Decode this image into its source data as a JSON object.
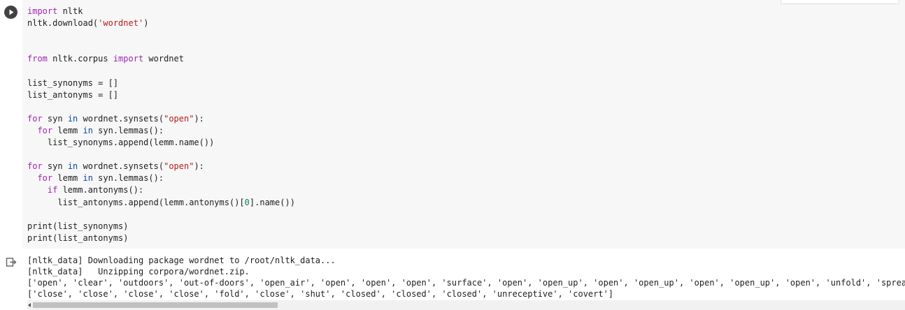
{
  "cell": {
    "run_icon": "play-circle-icon",
    "output_icon": "output-arrow-icon",
    "code_lines": [
      [
        {
          "t": "import",
          "c": "kw"
        },
        {
          "t": " nltk",
          "c": ""
        }
      ],
      [
        {
          "t": "nltk.download(",
          "c": ""
        },
        {
          "t": "'wordnet'",
          "c": "str"
        },
        {
          "t": ")",
          "c": ""
        }
      ],
      [],
      [],
      [
        {
          "t": "from",
          "c": "kw"
        },
        {
          "t": " nltk.corpus ",
          "c": ""
        },
        {
          "t": "import",
          "c": "kw"
        },
        {
          "t": " wordnet",
          "c": ""
        }
      ],
      [],
      [
        {
          "t": "list_synonyms = []",
          "c": ""
        }
      ],
      [
        {
          "t": "list_antonyms = []",
          "c": ""
        }
      ],
      [],
      [
        {
          "t": "for",
          "c": "kw"
        },
        {
          "t": " syn ",
          "c": ""
        },
        {
          "t": "in",
          "c": "kw2"
        },
        {
          "t": " wordnet.synsets(",
          "c": ""
        },
        {
          "t": "\"open\"",
          "c": "str"
        },
        {
          "t": "):",
          "c": ""
        }
      ],
      [
        {
          "t": "  ",
          "c": ""
        },
        {
          "t": "for",
          "c": "kw"
        },
        {
          "t": " lemm ",
          "c": ""
        },
        {
          "t": "in",
          "c": "kw2"
        },
        {
          "t": " syn.lemmas():",
          "c": ""
        }
      ],
      [
        {
          "t": "    list_synonyms.append(lemm.name())",
          "c": ""
        }
      ],
      [],
      [
        {
          "t": "for",
          "c": "kw"
        },
        {
          "t": " syn ",
          "c": ""
        },
        {
          "t": "in",
          "c": "kw2"
        },
        {
          "t": " wordnet.synsets(",
          "c": ""
        },
        {
          "t": "\"open\"",
          "c": "str"
        },
        {
          "t": "):",
          "c": ""
        }
      ],
      [
        {
          "t": "  ",
          "c": ""
        },
        {
          "t": "for",
          "c": "kw"
        },
        {
          "t": " lemm ",
          "c": ""
        },
        {
          "t": "in",
          "c": "kw2"
        },
        {
          "t": " syn.lemmas():",
          "c": ""
        }
      ],
      [
        {
          "t": "    ",
          "c": ""
        },
        {
          "t": "if",
          "c": "kw"
        },
        {
          "t": " lemm.antonyms():",
          "c": ""
        }
      ],
      [
        {
          "t": "      list_antonyms.append(lemm.antonyms()[",
          "c": ""
        },
        {
          "t": "0",
          "c": "num"
        },
        {
          "t": "].name())",
          "c": ""
        }
      ],
      [],
      [
        {
          "t": "print(list_synonyms)",
          "c": ""
        }
      ],
      [
        {
          "t": "print(list_antonyms)",
          "c": ""
        }
      ]
    ],
    "output_lines": [
      "[nltk_data] Downloading package wordnet to /root/nltk_data...",
      "[nltk_data]   Unzipping corpora/wordnet.zip.",
      "['open', 'clear', 'outdoors', 'out-of-doors', 'open_air', 'open', 'open', 'open', 'surface', 'open', 'open_up', 'open', 'open_up', 'open', 'open_up', 'open', 'unfold', 'spread', 'spread_out', 'open', 'open']",
      "['close', 'close', 'close', 'close', 'fold', 'close', 'shut', 'closed', 'closed', 'closed', 'unreceptive', 'covert']"
    ]
  }
}
